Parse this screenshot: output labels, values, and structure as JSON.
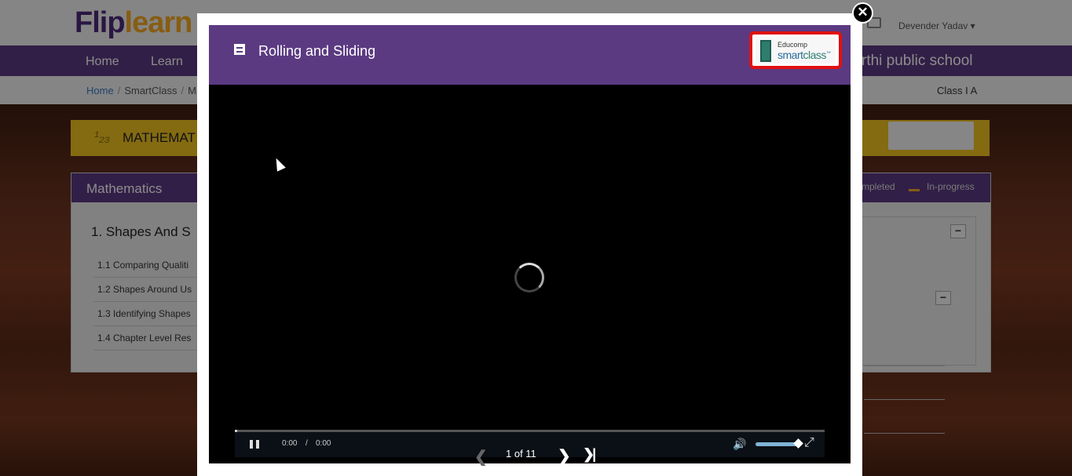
{
  "app": {
    "logo_part1": "Flip",
    "logo_part2": "learn",
    "user_name": "Devender Yadav ▾"
  },
  "nav": {
    "items": [
      "Home",
      "Learn"
    ],
    "school_name": "rthi public school"
  },
  "breadcrumb": {
    "home": "Home",
    "smartclass": "SmartClass",
    "partial": "M",
    "class_name": "Class I A"
  },
  "subject": {
    "icon_text": "¹₂₃",
    "name": "MATHEMAT"
  },
  "panel": {
    "title": "Mathematics",
    "legend_completed": "mpleted",
    "legend_inprogress": "In-progress",
    "chapter": "1. Shapes And S",
    "lessons": [
      "1.1 Comparing Qualiti",
      "1.2 Shapes Around Us",
      "1.3 Identifying Shapes",
      "1.4 Chapter Level Res"
    ],
    "collapse_symbol": "−"
  },
  "modal": {
    "close_symbol": "✕",
    "title": "Rolling and Sliding",
    "brand_small": "Educomp",
    "brand_big_1": "smart",
    "brand_big_2": "class",
    "brand_tm": "™"
  },
  "player": {
    "current_time": "0:00",
    "separator": "/",
    "duration": "0:00",
    "progress_fraction": 0.0,
    "volume_fraction": 0.95,
    "slide_counter": "1 of 11",
    "prev_symbol": "❮",
    "next_symbol": "❯",
    "last_symbol": "❯|",
    "volume_symbol": "🔊",
    "fullscreen_symbol": "⤢"
  }
}
